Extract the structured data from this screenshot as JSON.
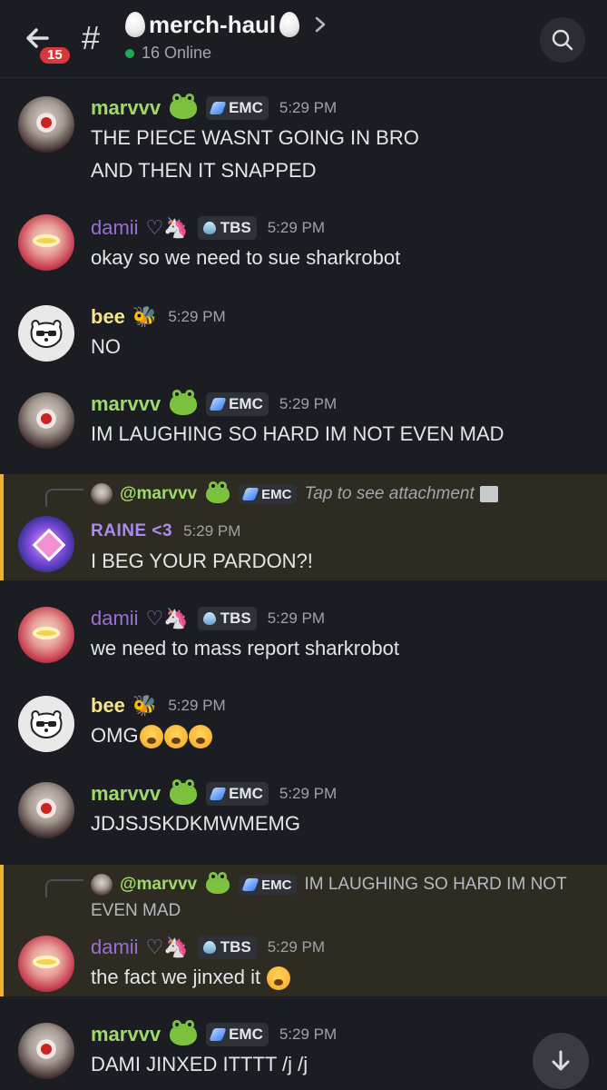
{
  "header": {
    "unread_badge": "15",
    "hash": "#",
    "channel_name": "merch-haul",
    "online_text": "16 Online"
  },
  "messages": [
    {
      "username": "marvvv",
      "tag": "EMC",
      "time": "5:29 PM",
      "lines": [
        "THE PIECE WASNT GOING IN BRO",
        "AND THEN IT SNAPPED"
      ]
    },
    {
      "username": "damii",
      "tag": "TBS",
      "time": "5:29 PM",
      "lines": [
        "okay so we need to sue sharkrobot"
      ]
    },
    {
      "username": "bee",
      "time": "5:29 PM",
      "lines": [
        "NO"
      ]
    },
    {
      "username": "marvvv",
      "tag": "EMC",
      "time": "5:29 PM",
      "lines": [
        "IM LAUGHING SO HARD IM NOT EVEN MAD"
      ]
    },
    {
      "username": "RAINE <3",
      "time": "5:29 PM",
      "lines": [
        "I BEG YOUR PARDON?!"
      ],
      "reply": {
        "username": "@marvvv",
        "tag": "EMC",
        "text": "Tap to see attachment"
      }
    },
    {
      "username": "damii",
      "tag": "TBS",
      "time": "5:29 PM",
      "lines": [
        "we need to mass report sharkrobot"
      ]
    },
    {
      "username": "bee",
      "time": "5:29 PM",
      "lines": [
        "OMG"
      ]
    },
    {
      "username": "marvvv",
      "tag": "EMC",
      "time": "5:29 PM",
      "lines": [
        "JDJSJSKDKMWMEMG"
      ]
    },
    {
      "username": "damii",
      "tag": "TBS",
      "time": "5:29 PM",
      "lines": [
        "the fact we jinxed it"
      ],
      "reply": {
        "username": "@marvvv",
        "tag": "EMC",
        "text": "IM LAUGHING SO HARD IM NOT",
        "text_cont": "EVEN MAD"
      }
    },
    {
      "username": "marvvv",
      "tag": "EMC",
      "time": "5:29 PM",
      "lines": [
        "DAMI JINXED ITTTT /j /j"
      ]
    }
  ],
  "icons": {
    "back": "arrow-left-icon",
    "search": "search-icon",
    "scroll_down": "arrow-down-icon",
    "image": "image-icon"
  },
  "colors": {
    "background": "#1c1d22",
    "online_dot": "#23a55a",
    "badge": "#da373c",
    "reply_highlight_bar": "#f0b232"
  }
}
